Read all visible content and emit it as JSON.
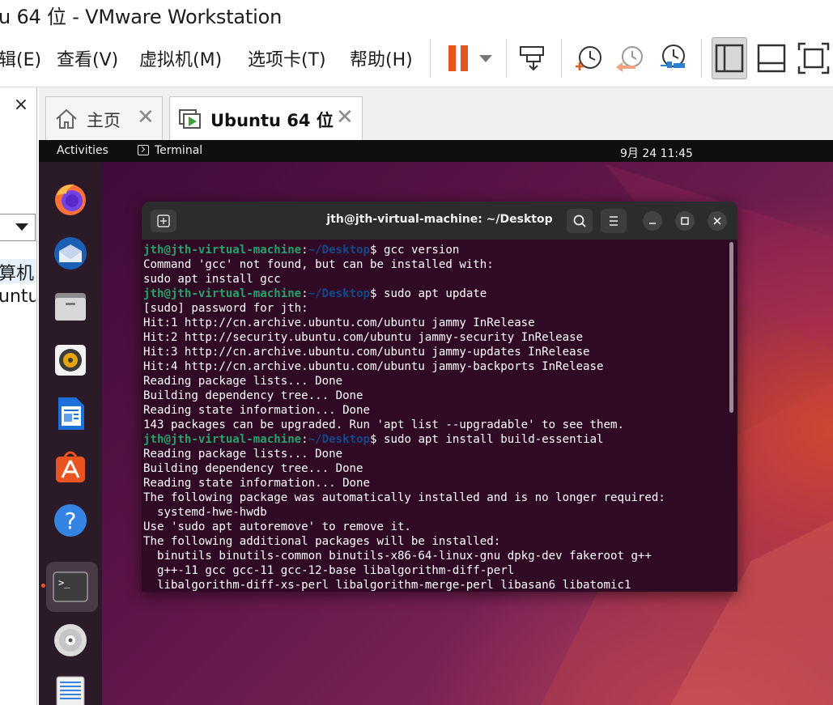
{
  "window": {
    "title": "u 64 位 - VMware Workstation"
  },
  "menubar": {
    "items": [
      "辑(E)",
      "查看(V)",
      "虚拟机(M)",
      "选项卡(T)",
      "帮助(H)"
    ]
  },
  "toolbar": {
    "buttons": [
      {
        "name": "pause-icon"
      },
      {
        "name": "send-keys-icon"
      },
      {
        "name": "take-snapshot-icon"
      },
      {
        "name": "revert-snapshot-icon"
      },
      {
        "name": "snapshot-manager-icon"
      },
      {
        "name": "library-view-icon",
        "active": true
      },
      {
        "name": "thumbnail-bar-icon"
      },
      {
        "name": "fullscreen-icon"
      }
    ],
    "accent": "#e95420"
  },
  "library": {
    "close_label": "×",
    "tree_items": [
      "算机",
      "untu"
    ]
  },
  "tabs": [
    {
      "label": "主页",
      "icon": "home-icon",
      "active": false
    },
    {
      "label": "Ubuntu 64 位",
      "icon": "vm-icon",
      "active": true
    }
  ],
  "guest": {
    "topbar": {
      "activities": "Activities",
      "app": "Terminal",
      "clock": "9月 24  11:45"
    },
    "dock": [
      "firefox-icon",
      "thunderbird-icon",
      "files-icon",
      "rhythmbox-icon",
      "libreoffice-writer-icon",
      "app-center-icon",
      "help-icon",
      "terminal-icon",
      "dvd-icon",
      "text-editor-icon"
    ],
    "terminal": {
      "title": "jth@jth-virtual-machine: ~/Desktop",
      "prompt_user": "jth@jth-virtual-machine",
      "prompt_path": "~/Desktop",
      "lines": [
        {
          "type": "prompt",
          "cmd": " gcc version"
        },
        {
          "type": "out",
          "text": "Command 'gcc' not found, but can be installed with:"
        },
        {
          "type": "out",
          "text": "sudo apt install gcc"
        },
        {
          "type": "prompt",
          "cmd": " sudo apt update"
        },
        {
          "type": "out",
          "text": "[sudo] password for jth:"
        },
        {
          "type": "out",
          "text": "Hit:1 http://cn.archive.ubuntu.com/ubuntu jammy InRelease"
        },
        {
          "type": "out",
          "text": "Hit:2 http://security.ubuntu.com/ubuntu jammy-security InRelease"
        },
        {
          "type": "out",
          "text": "Hit:3 http://cn.archive.ubuntu.com/ubuntu jammy-updates InRelease"
        },
        {
          "type": "out",
          "text": "Hit:4 http://cn.archive.ubuntu.com/ubuntu jammy-backports InRelease"
        },
        {
          "type": "out",
          "text": "Reading package lists... Done"
        },
        {
          "type": "out",
          "text": "Building dependency tree... Done"
        },
        {
          "type": "out",
          "text": "Reading state information... Done"
        },
        {
          "type": "out",
          "text": "143 packages can be upgraded. Run 'apt list --upgradable' to see them."
        },
        {
          "type": "prompt",
          "cmd": " sudo apt install build-essential"
        },
        {
          "type": "out",
          "text": "Reading package lists... Done"
        },
        {
          "type": "out",
          "text": "Building dependency tree... Done"
        },
        {
          "type": "out",
          "text": "Reading state information... Done"
        },
        {
          "type": "out",
          "text": "The following package was automatically installed and is no longer required:"
        },
        {
          "type": "out",
          "text": "  systemd-hwe-hwdb"
        },
        {
          "type": "out",
          "text": "Use 'sudo apt autoremove' to remove it."
        },
        {
          "type": "out",
          "text": "The following additional packages will be installed:"
        },
        {
          "type": "out",
          "text": "  binutils binutils-common binutils-x86-64-linux-gnu dpkg-dev fakeroot g++"
        },
        {
          "type": "out",
          "text": "  g++-11 gcc gcc-11 gcc-12-base libalgorithm-diff-perl"
        },
        {
          "type": "out",
          "text": "  libalgorithm-diff-xs-perl libalgorithm-merge-perl libasan6 libatomic1"
        }
      ]
    }
  }
}
